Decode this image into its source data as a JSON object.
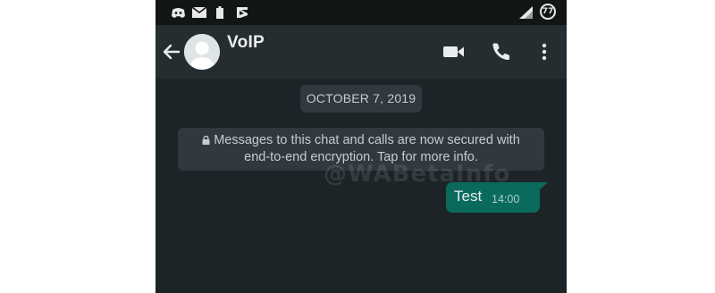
{
  "status_bar": {
    "battery_level": "77",
    "icons": [
      "discord-icon",
      "mail-icon",
      "battery-icon",
      "feedly-icon",
      "signal-icon"
    ]
  },
  "header": {
    "contact_name": "VoIP",
    "icons": [
      "back-arrow-icon",
      "avatar",
      "video-call-icon",
      "voice-call-icon",
      "more-options-icon"
    ]
  },
  "chat": {
    "date_chip": "OCTOBER 7, 2019",
    "system_message_line1": "Messages to this chat and calls are now secured with",
    "system_message_line2": "end-to-end encryption. Tap for more info.",
    "watermark": "@WABetaInfo",
    "messages": [
      {
        "direction": "outgoing",
        "text": "Test",
        "time": "14:00"
      }
    ]
  },
  "colors": {
    "status_bar_bg": "#121617",
    "header_bg": "#262d31",
    "chat_bg": "#1d2428",
    "chip_bg": "#2f393e",
    "outgoing_bubble": "#0a6b5c",
    "text_primary": "#e9edef",
    "text_secondary": "#c4ccd0"
  }
}
